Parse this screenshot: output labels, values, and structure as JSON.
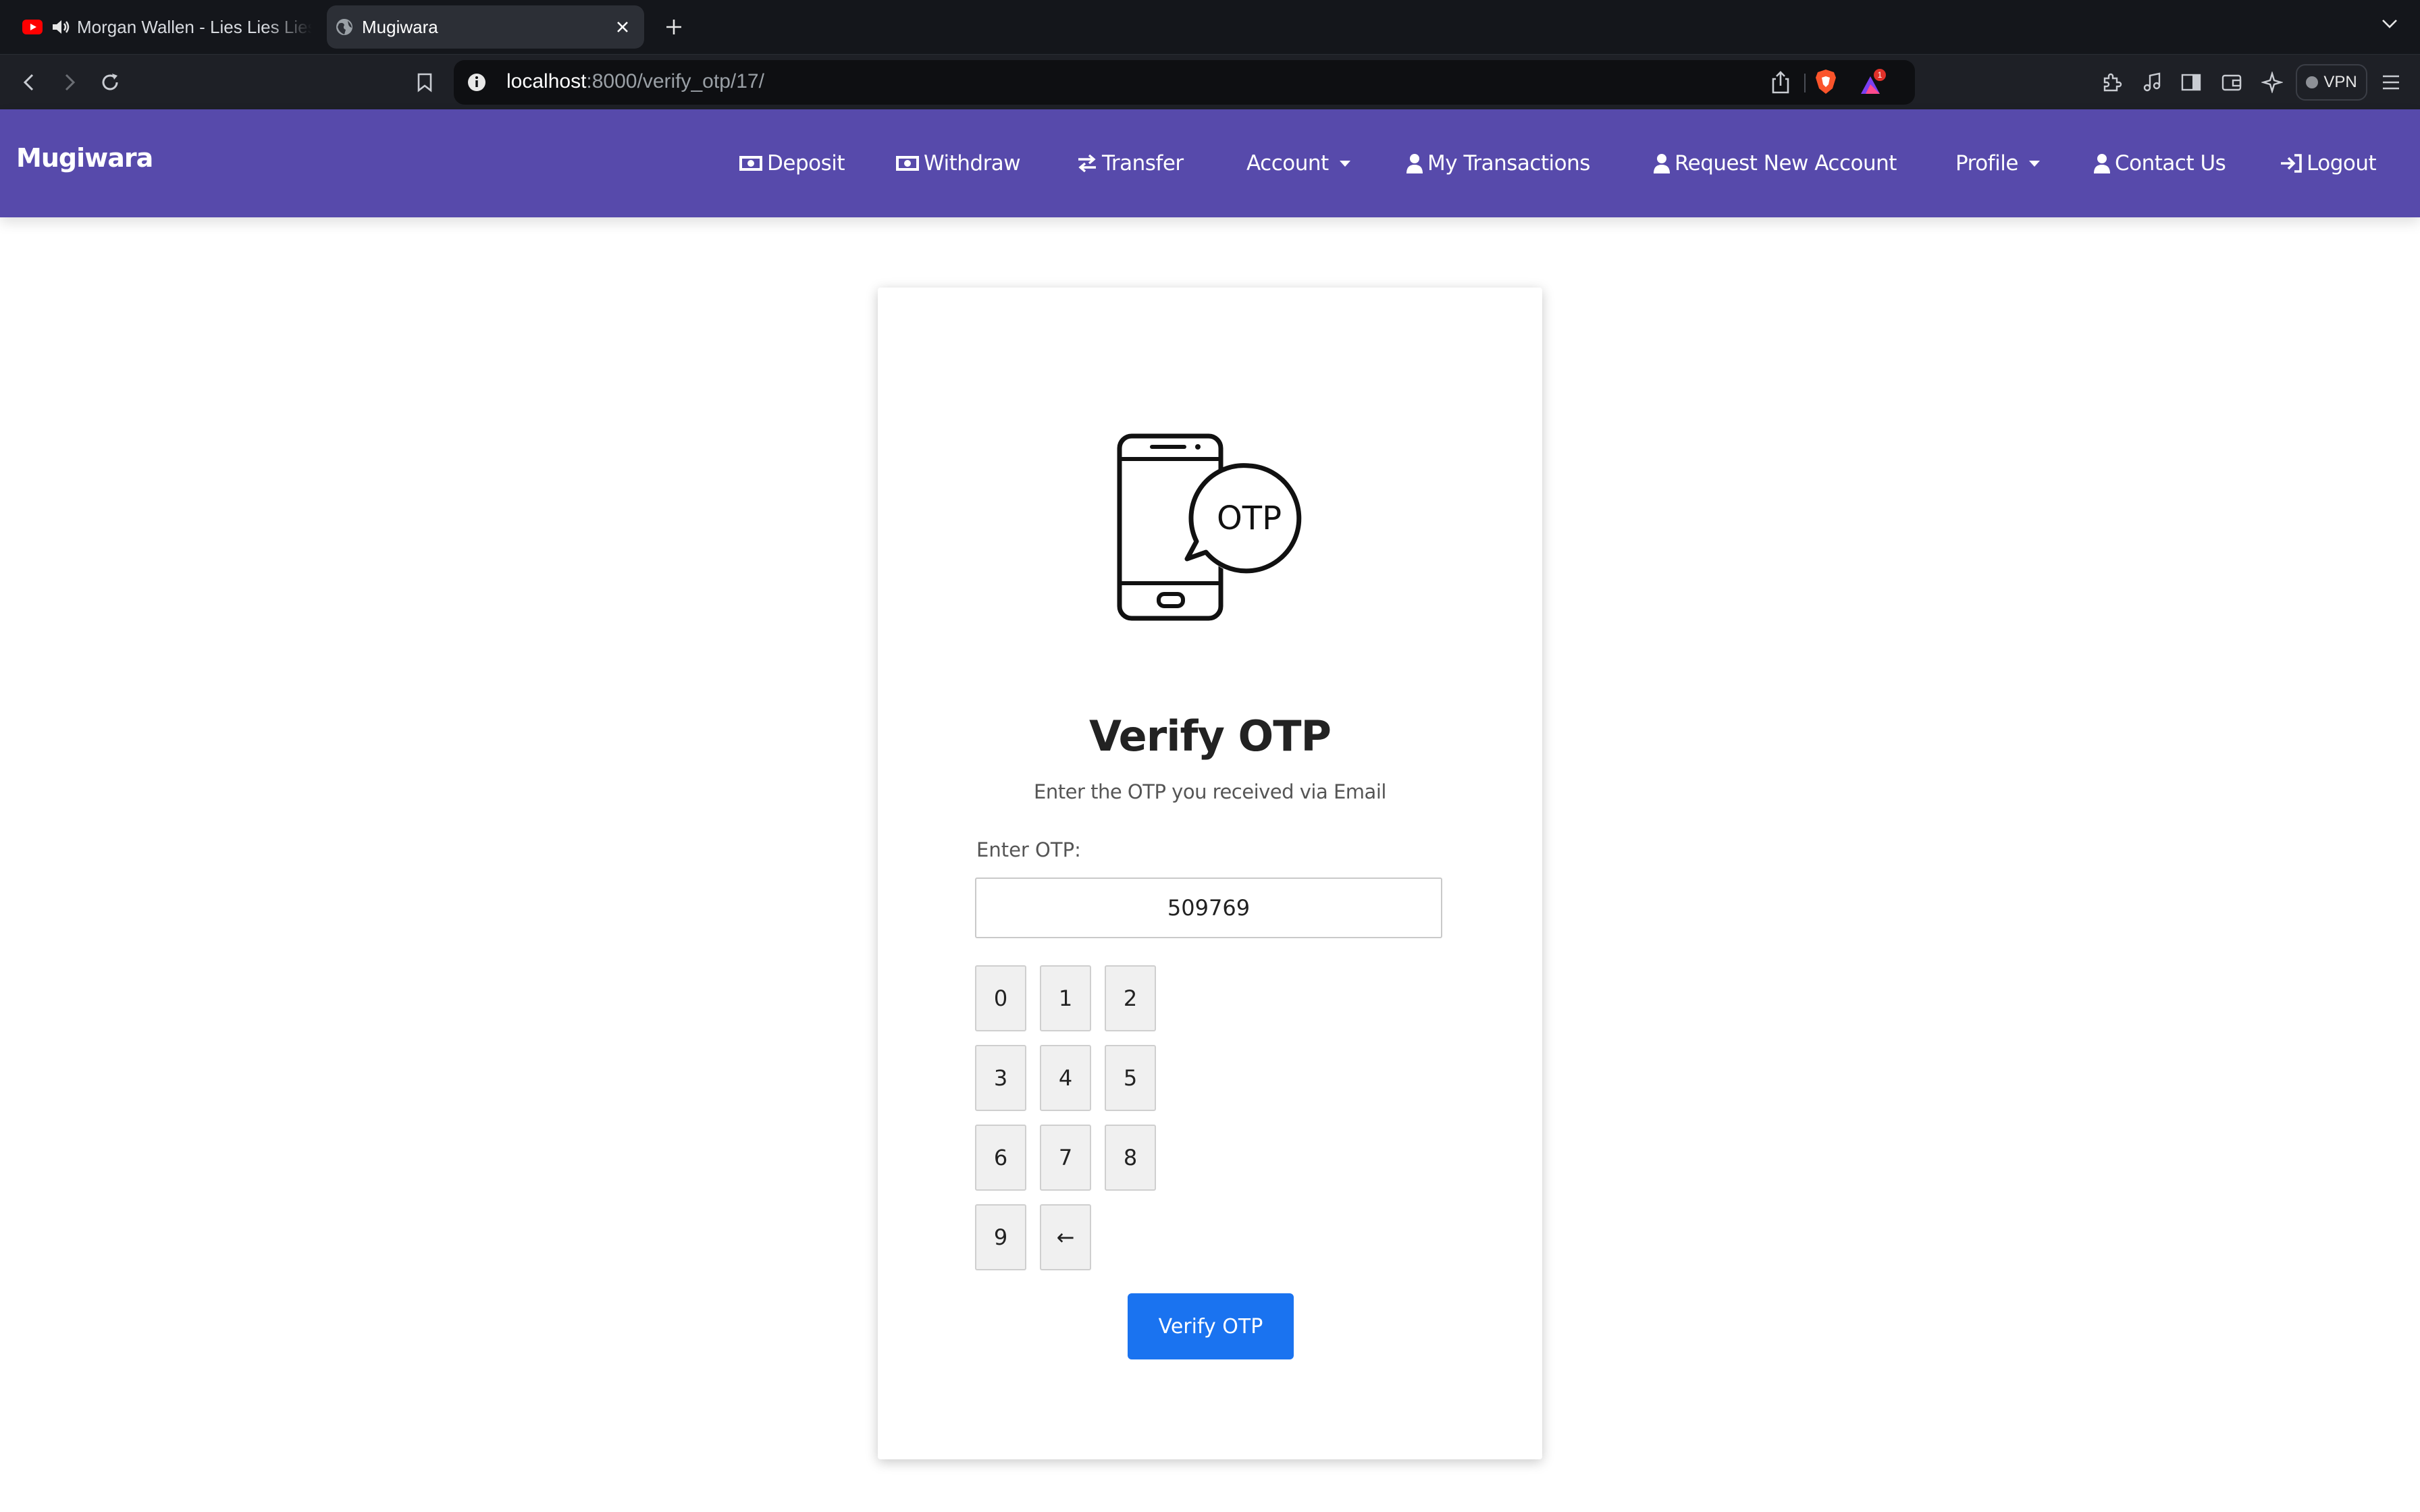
{
  "browser": {
    "tabs": [
      {
        "title": "Morgan Wallen - Lies Lies Lies",
        "active": false,
        "favicon": "youtube-icon",
        "audio": "speaker-icon"
      },
      {
        "title": "Mugiwara",
        "active": true,
        "favicon": "globe-icon"
      }
    ],
    "address": {
      "host": "localhost",
      "path": ":8000/verify_otp/17/"
    },
    "rewards_badge": "1",
    "vpn_label": "VPN"
  },
  "navbar": {
    "brand": "Mugiwara",
    "items": [
      {
        "label": "Deposit",
        "icon": "money-bill-icon"
      },
      {
        "label": "Withdraw",
        "icon": "money-bill-icon"
      },
      {
        "label": "Transfer",
        "icon": "exchange-arrows-icon"
      },
      {
        "label": "Account",
        "icon": "caret-down-icon"
      },
      {
        "label": "My Transactions",
        "icon": "user-icon"
      },
      {
        "label": "Request New Account",
        "icon": "user-icon"
      },
      {
        "label": "Profile",
        "icon": "caret-down-icon"
      },
      {
        "label": "Contact Us",
        "icon": "user-icon"
      },
      {
        "label": "Logout",
        "icon": "sign-out-icon"
      }
    ],
    "color": "#574aab"
  },
  "card": {
    "illustration_text": "OTP",
    "title": "Verify OTP",
    "subtitle": "Enter the OTP you received via Email",
    "otp_label": "Enter OTP:",
    "otp_value": "509769",
    "keypad": [
      "0",
      "1",
      "2",
      "3",
      "4",
      "5",
      "6",
      "7",
      "8",
      "9",
      "←"
    ],
    "submit_label": "Verify OTP",
    "submit_color": "#1a73f0"
  }
}
